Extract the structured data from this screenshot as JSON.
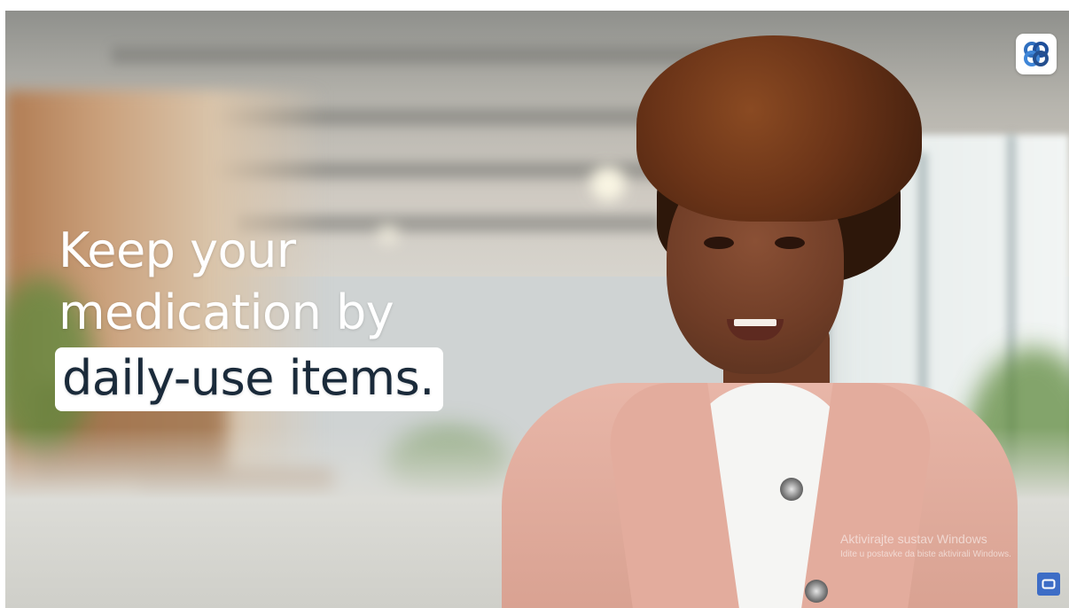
{
  "video": {
    "caption_line1": "Keep your",
    "caption_line2": "medication by",
    "caption_highlight": "daily-use items.",
    "logo_icon": "brand-logo-icon",
    "corner_control_icon": "screen-control-icon"
  },
  "os_watermark": {
    "title": "Aktivirajte sustav Windows",
    "subtitle": "Idite u postavke da biste aktivirali Windows."
  },
  "colors": {
    "highlight_text": "#1a2a3a",
    "logo_blue": "#2f6fbf",
    "corner_button": "#3d6dc6"
  }
}
